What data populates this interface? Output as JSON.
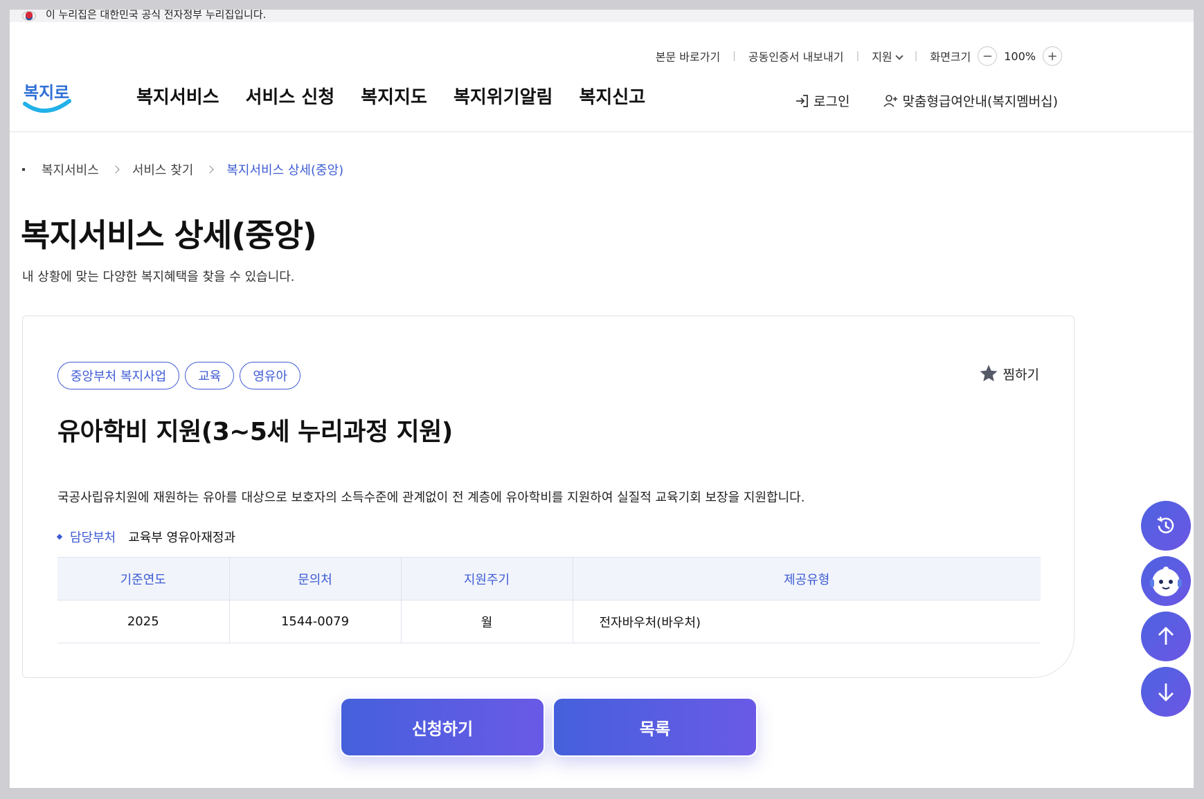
{
  "gov_banner": {
    "text": "이 누리집은 대한민국 공식 전자정부 누리집입니다."
  },
  "utility": {
    "skip": "본문 바로가기",
    "cert": "공동인증서 내보내기",
    "support": "지원",
    "screen_size": "화면크기",
    "zoom_minus": "−",
    "zoom": "100%",
    "zoom_plus": "+"
  },
  "logo": {
    "text": "복지로"
  },
  "menu": {
    "items": [
      "복지서비스",
      "서비스 신청",
      "복지지도",
      "복지위기알림",
      "복지신고"
    ],
    "login": "로그인",
    "membership": "맞춤형급여안내(복지멤버십)"
  },
  "breadcrumb": [
    "복지서비스",
    "서비스 찾기",
    "복지서비스 상세(중앙)"
  ],
  "page": {
    "title": "복지서비스 상세(중앙)",
    "subtitle": "내 상황에 맞는 다양한 복지혜택을 찾을 수 있습니다."
  },
  "card": {
    "tags": [
      "중앙부처 복지사업",
      "교육",
      "영유아"
    ],
    "favorite": "찜하기",
    "title": "유아학비 지원(3~5세 누리과정 지원)",
    "description": "국공사립유치원에 재원하는 유아를 대상으로 보호자의 소득수준에 관계없이 전 계층에 유아학비를 지원하여 실질적 교육기회 보장을 지원합니다.",
    "dept_label": "담당부처",
    "dept_value": "교육부 영유아재정과",
    "table": {
      "headers": [
        "기준연도",
        "문의처",
        "지원주기",
        "제공유형"
      ],
      "row": [
        "2025",
        "1544-0079",
        "월",
        "전자바우처(바우처)"
      ]
    }
  },
  "buttons": {
    "apply": "신청하기",
    "list": "목록"
  },
  "colors": {
    "accent": "#3d5bd4",
    "gradient_start": "#4560dc",
    "gradient_end": "#6a5ae6"
  },
  "floating": [
    "history-icon",
    "chatbot-icon",
    "arrow-up-icon",
    "arrow-down-icon"
  ]
}
